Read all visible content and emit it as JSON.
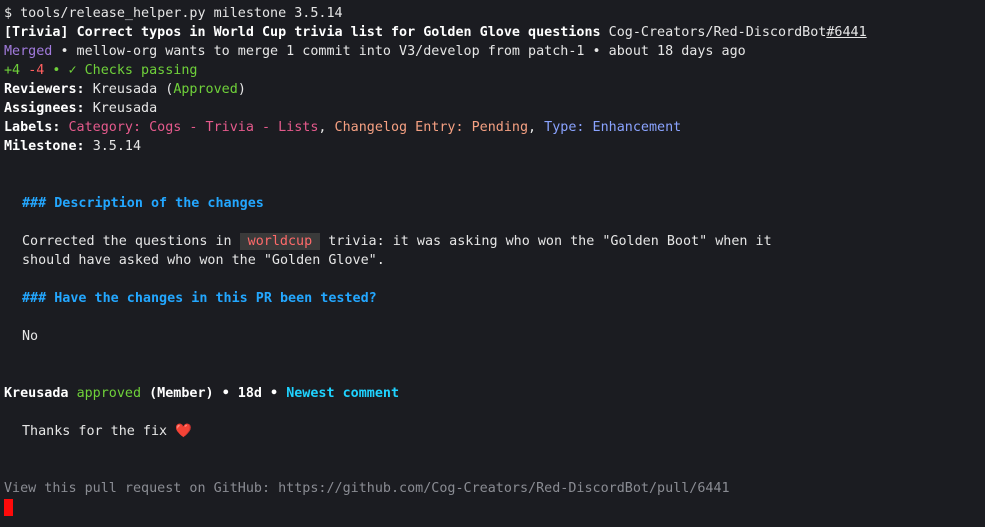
{
  "prompt": {
    "symbol": "$",
    "command": "tools/release_helper.py milestone 3.5.14"
  },
  "pr": {
    "tag": "[Trivia]",
    "title": "Correct typos in World Cup trivia list for Golden Glove questions",
    "repo": "Cog-Creators/Red-DiscordBot",
    "number": "#6441",
    "state": "Merged",
    "merge_text": "• mellow-org wants to merge 1 commit into V3/develop from patch-1 • about 18 days ago",
    "additions": "+4",
    "deletions": "-4",
    "checks": "• ✓ Checks passing"
  },
  "meta": {
    "reviewers_label": "Reviewers:",
    "reviewer_name": "Kreusada",
    "reviewer_status_open": " (",
    "reviewer_status": "Approved",
    "reviewer_status_close": ")",
    "assignees_label": "Assignees:",
    "assignee_name": "Kreusada",
    "labels_label": "Labels:",
    "label_1": "Category: Cogs - Trivia - Lists",
    "label_sep": ",",
    "label_2": "Changelog Entry: Pending",
    "label_3_key": "Type:",
    "label_3_value": "Enhancement",
    "milestone_label": "Milestone:",
    "milestone_value": "3.5.14"
  },
  "body": {
    "heading_1": "### Description of the changes",
    "para_1_pre": "Corrected the questions in ",
    "para_1_code": "worldcup",
    "para_1_post": " trivia: it was asking who won the \"Golden Boot\" when it",
    "para_1_line2": "should have asked who won the \"Golden Glove\".",
    "heading_2": "### Have the changes in this PR been tested?",
    "para_2": "No"
  },
  "comment": {
    "author": "Kreusada",
    "action": "approved",
    "role": "(Member)",
    "age": "• 18d •",
    "newest": "Newest comment",
    "text": "Thanks for the fix",
    "emoji": "❤️"
  },
  "footer": {
    "link_text": "View this pull request on GitHub: https://github.com/Cog-Creators/Red-DiscordBot/pull/6441"
  },
  "colors": {
    "background": "#1b1c21",
    "merged": "#a27bde",
    "approved": "#6fd13a",
    "heading": "#23a7ff",
    "newest_comment": "#1fd2ff",
    "cursor": "#ff0a0a"
  }
}
